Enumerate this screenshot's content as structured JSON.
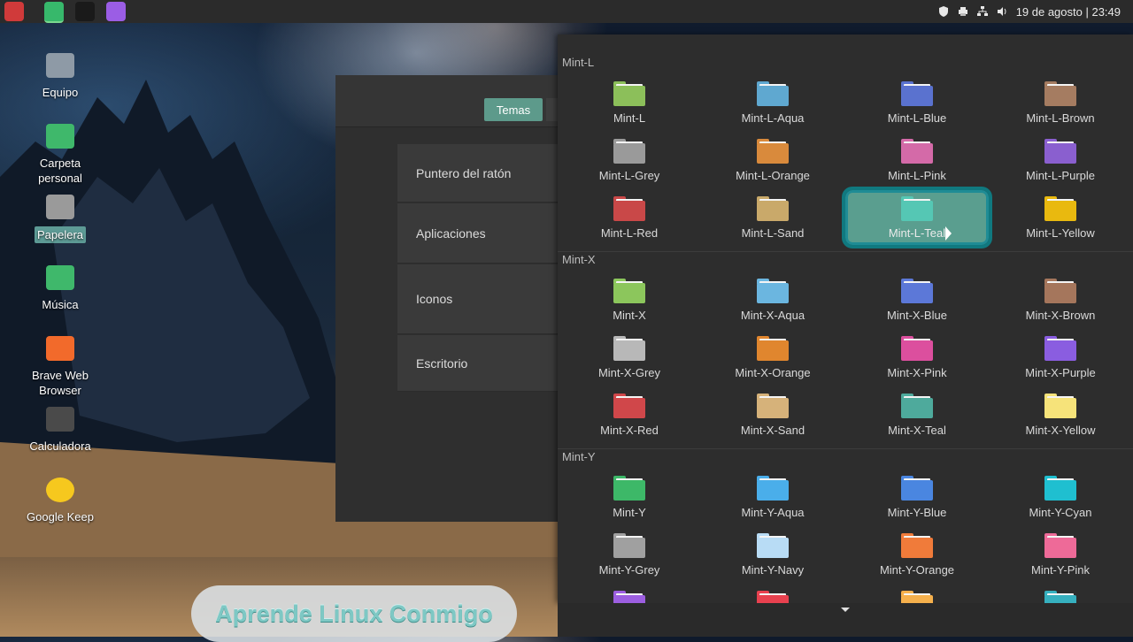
{
  "panel": {
    "apps": [
      {
        "icon": "red-bird-app-icon",
        "color": "#d03a3a"
      },
      {
        "icon": "files-folder-icon",
        "color": "#37b86b"
      },
      {
        "icon": "terminal-icon",
        "color": "#1a1a1a"
      },
      {
        "icon": "color-picker-icon",
        "color": "#9b5de5"
      }
    ],
    "clock": "19 de agosto | 23:49",
    "tray_icons": [
      "shield-icon",
      "printer-icon",
      "network-icon",
      "volume-icon"
    ]
  },
  "desktop": {
    "icons": [
      {
        "label": "Equipo",
        "icon": "computer-icon"
      },
      {
        "label": "Carpeta personal",
        "icon": "home-folder-icon"
      },
      {
        "label": "Papelera",
        "icon": "trash-icon",
        "selected": true
      },
      {
        "label": "Música",
        "icon": "music-folder-icon"
      },
      {
        "label": "Brave Web Browser",
        "icon": "brave-browser-icon"
      },
      {
        "label": "Calculadora",
        "icon": "calculator-icon"
      },
      {
        "label": "Google Keep",
        "icon": "google-keep-icon"
      }
    ]
  },
  "settings": {
    "tab_active": "Temas",
    "rows": [
      "Puntero del ratón",
      "Aplicaciones",
      "Iconos",
      "Escritorio"
    ]
  },
  "chooser": {
    "sections": [
      {
        "title": "Mint-L",
        "items": [
          {
            "label": "Mint-L",
            "color": "#8cbf5a"
          },
          {
            "label": "Mint-L-Aqua",
            "color": "#5fa8d0"
          },
          {
            "label": "Mint-L-Blue",
            "color": "#5a72cf"
          },
          {
            "label": "Mint-L-Brown",
            "color": "#a57c61"
          },
          {
            "label": "Mint-L-Grey",
            "color": "#9a9a9a"
          },
          {
            "label": "Mint-L-Orange",
            "color": "#d98a3c"
          },
          {
            "label": "Mint-L-Pink",
            "color": "#d46aa8"
          },
          {
            "label": "Mint-L-Purple",
            "color": "#8a5fcf"
          },
          {
            "label": "Mint-L-Red",
            "color": "#c94848"
          },
          {
            "label": "Mint-L-Sand",
            "color": "#c9a96a"
          },
          {
            "label": "Mint-L-Teal",
            "color": "#55c7b4",
            "selected": true
          },
          {
            "label": "Mint-L-Yellow",
            "color": "#e9b90f"
          }
        ]
      },
      {
        "title": "Mint-X",
        "items": [
          {
            "label": "Mint-X",
            "color": "#8cc65c"
          },
          {
            "label": "Mint-X-Aqua",
            "color": "#6bb6e0"
          },
          {
            "label": "Mint-X-Blue",
            "color": "#5c78d8"
          },
          {
            "label": "Mint-X-Brown",
            "color": "#a5765c"
          },
          {
            "label": "Mint-X-Grey",
            "color": "#b8b8b8"
          },
          {
            "label": "Mint-X-Orange",
            "color": "#e0862e"
          },
          {
            "label": "Mint-X-Pink",
            "color": "#dc4f9e"
          },
          {
            "label": "Mint-X-Purple",
            "color": "#8a5de0"
          },
          {
            "label": "Mint-X-Red",
            "color": "#d0474a"
          },
          {
            "label": "Mint-X-Sand",
            "color": "#d6b27a"
          },
          {
            "label": "Mint-X-Teal",
            "color": "#4eaa9c"
          },
          {
            "label": "Mint-X-Yellow",
            "color": "#f6e37a"
          }
        ]
      },
      {
        "title": "Mint-Y",
        "items": [
          {
            "label": "Mint-Y",
            "color": "#3db868"
          },
          {
            "label": "Mint-Y-Aqua",
            "color": "#4aaeea"
          },
          {
            "label": "Mint-Y-Blue",
            "color": "#4a86e0"
          },
          {
            "label": "Mint-Y-Cyan",
            "color": "#1fbfd0"
          },
          {
            "label": "Mint-Y-Grey",
            "color": "#a0a0a0"
          },
          {
            "label": "Mint-Y-Navy",
            "color": "#b8dcf5"
          },
          {
            "label": "Mint-Y-Orange",
            "color": "#f07b3a"
          },
          {
            "label": "Mint-Y-Pink",
            "color": "#ee6a98"
          },
          {
            "label": "",
            "color": "#9c5ee0"
          },
          {
            "label": "",
            "color": "#e8414f"
          },
          {
            "label": "",
            "color": "#f5b04c"
          },
          {
            "label": "",
            "color": "#36b0bf"
          }
        ]
      }
    ]
  },
  "watermark": "Aprende Linux Conmigo"
}
